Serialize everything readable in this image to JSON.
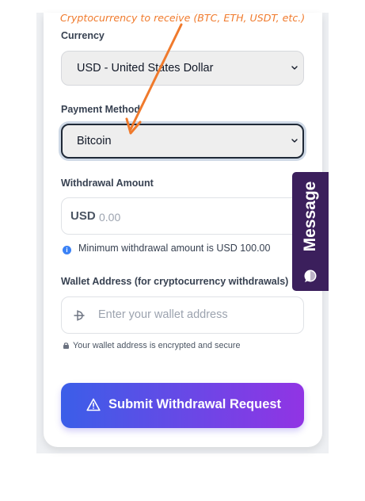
{
  "annotation": {
    "text": "Cryptocurrency to receive (BTC, ETH, USDT, etc.)",
    "color": "#f07a2c"
  },
  "form": {
    "currency": {
      "label": "Currency",
      "selected": "USD - United States Dollar"
    },
    "payment_method": {
      "label": "Payment Method",
      "selected": "Bitcoin"
    },
    "withdrawal_amount": {
      "label": "Withdrawal Amount",
      "currency_tag": "USD",
      "placeholder": "0.00",
      "hint": "Minimum withdrawal amount is USD 100.00"
    },
    "wallet_address": {
      "label": "Wallet Address (for cryptocurrency withdrawals)",
      "placeholder": "Enter your wallet address",
      "note": "Your wallet address is encrypted and secure"
    },
    "submit": {
      "label": "Submit Withdrawal Request",
      "gradient_start": "#3b5ee8",
      "gradient_end": "#9134e4"
    }
  },
  "message_tab": {
    "label": "Message",
    "color": "#3b1f5c"
  },
  "icons": {
    "select_chevron": "chevron-down-icon",
    "hint": "info-icon",
    "wallet": "wallet-icon",
    "secure": "lock-icon",
    "submit": "warning-icon",
    "message": "chat-bubble-icon"
  }
}
